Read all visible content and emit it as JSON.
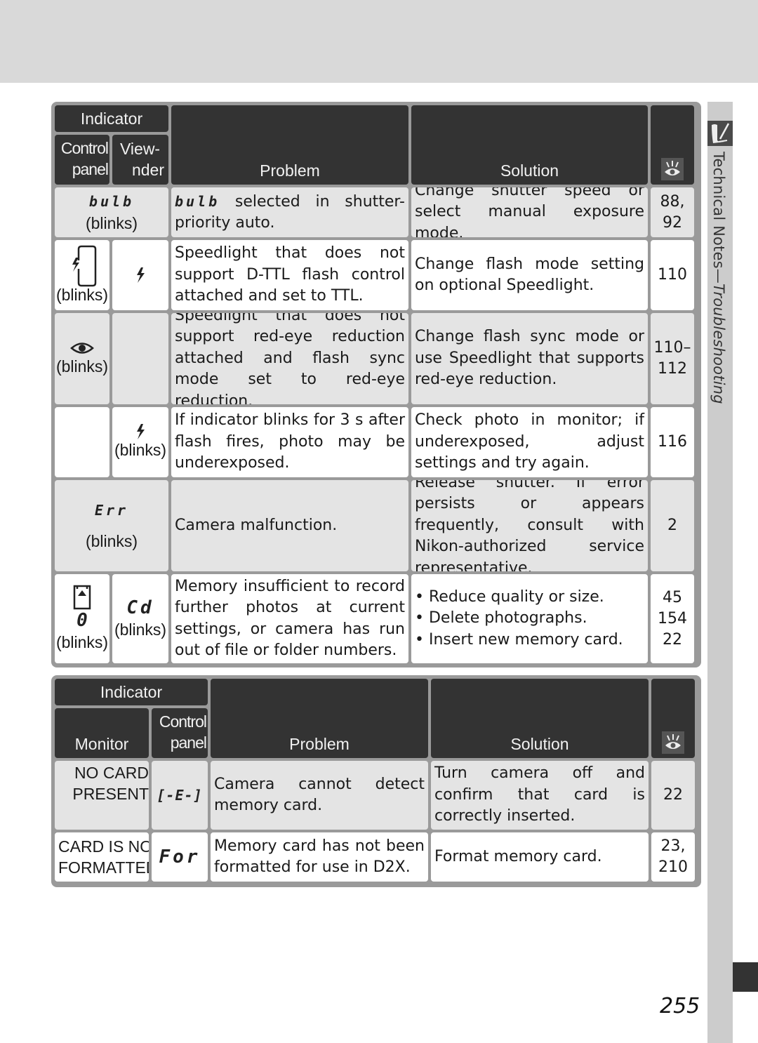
{
  "section_title": "Technical Notes",
  "section_subtitle": "Troubleshooting",
  "page_number": "255",
  "colors": {
    "header_bg": "#333333",
    "border": "#9a9a9a",
    "row_shaded": "#e4e4e4",
    "row_plain": "#ffffff",
    "side_strip": "#cccccc"
  },
  "table1": {
    "headers": {
      "indicator": "Indicator",
      "control_panel": [
        "Control",
        "panel"
      ],
      "viewfinder": [
        "View-",
        "nder"
      ],
      "problem": "Problem",
      "solution": "Solution",
      "page_ref_icon": "page-reference-eye-icon"
    },
    "rows": [
      {
        "control_panel": "bulb",
        "control_panel_note": "(blinks)",
        "merged_indicator": true,
        "problem_prefix": "bulb",
        "problem": "selected in shutter-priority auto.",
        "solution": "Change shutter speed or select manual exposure mode.",
        "pages": [
          "88,",
          "92"
        ]
      },
      {
        "control_panel_icon": "flash-bracket-icon",
        "control_panel_note": "(blinks)",
        "viewfinder_icon": "flash-icon",
        "problem": "Speedlight that does not support D-TTL flash control attached and set to TTL.",
        "solution": "Change flash mode setting on optional Speedlight.",
        "pages": [
          "110"
        ]
      },
      {
        "control_panel_icon": "red-eye-icon",
        "control_panel_note": "(blinks)",
        "viewfinder": "",
        "problem": "Speedlight that does not support red-eye reduction attached and flash sync mode set to red-eye reduction.",
        "solution": "Change flash sync mode or use Speedlight that supports red-eye reduction.",
        "pages": [
          "110–",
          "112"
        ]
      },
      {
        "control_panel": "",
        "viewfinder_icon": "flash-icon",
        "viewfinder_note": "(blinks)",
        "problem": "If indicator blinks for 3 s after flash fires, photo may be underexposed.",
        "solution": "Check photo in monitor; if underexposed, adjust settings and try again.",
        "pages": [
          "116"
        ]
      },
      {
        "control_panel": "Err",
        "control_panel_note": "(blinks)",
        "merged_indicator": true,
        "problem": "Camera malfunction.",
        "solution": "Release shutter.  If error persists or appears frequently, consult with Nikon-authorized service representative.",
        "pages": [
          "2"
        ]
      },
      {
        "control_panel_icon": "memory-card-icon",
        "control_panel_value": "0",
        "control_panel_note": "(blinks)",
        "viewfinder": "Cd",
        "viewfinder_note": "(blinks)",
        "problem": "Memory insufficient to record further photos at current settings, or camera has run out of file or folder numbers.",
        "solution_bullets": [
          "Reduce quality or size.",
          "Delete photographs.",
          "Insert new memory card."
        ],
        "pages": [
          "45",
          "154",
          "22"
        ]
      }
    ]
  },
  "table2": {
    "headers": {
      "indicator": "Indicator",
      "monitor": "Monitor",
      "control_panel": [
        "Control",
        "panel"
      ],
      "problem": "Problem",
      "solution": "Solution",
      "page_ref_icon": "page-reference-eye-icon"
    },
    "rows": [
      {
        "monitor": [
          "NO CARD",
          "PRESENT"
        ],
        "control_panel": "[-E-]",
        "problem": "Camera cannot detect memory card.",
        "solution": "Turn camera off and confirm that card is correctly inserted.",
        "pages": [
          "22"
        ]
      },
      {
        "monitor": [
          "CARD IS NOT",
          "FORMATTED"
        ],
        "control_panel": "For",
        "problem": "Memory card has not been formatted for use in D2X.",
        "solution": "Format memory card.",
        "pages": [
          "23,",
          "210"
        ]
      }
    ]
  }
}
